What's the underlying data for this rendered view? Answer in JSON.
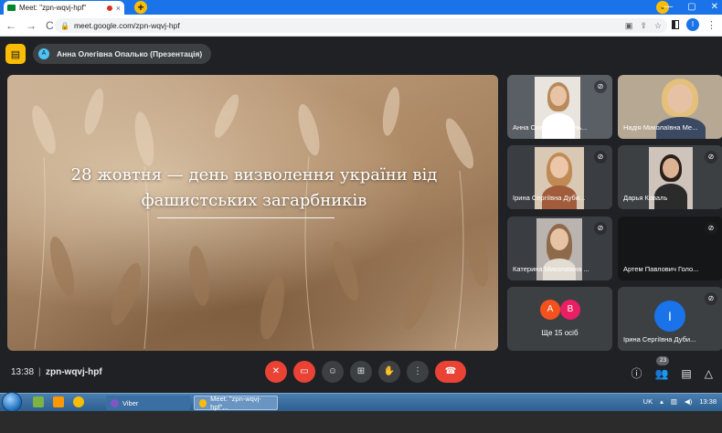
{
  "browser": {
    "tab_title": "Meet: \"zpn-wqvj-hpf\"",
    "tab_close": "×",
    "new_tab": "+",
    "tab_search": "⌄",
    "window_controls": [
      "—",
      "▢",
      "✕"
    ],
    "nav_back": "←",
    "nav_forward": "→",
    "nav_reload": "C",
    "url": "meet.google.com/zpn-wqvj-hpf",
    "profile_initial": "I"
  },
  "meet": {
    "presenter_label": "Анна Олегівна Опалько (Презентація)",
    "presenter_initial": "A",
    "slide_title_line1": "28 жовтня — день визволення україни від",
    "slide_title_line2": "фашистських загарбників",
    "participants": [
      {
        "name": "Анна Олегівна Опаль..."
      },
      {
        "name": "Надія Миколаївна Ме..."
      },
      {
        "name": "Ірина Сергіївна Дуби..."
      },
      {
        "name": "Дарья Коваль"
      },
      {
        "name": "Катерина Миколаївна ..."
      },
      {
        "name": "Артем Павлович Голо..."
      }
    ],
    "more_tile": {
      "avatars": [
        "A",
        "B"
      ],
      "label": "Ще 15 осіб",
      "colors": [
        "#f4511e",
        "#e91e63"
      ]
    },
    "last_tile": {
      "name": "Ірина Сергіївна Дуби...",
      "initial": "I"
    },
    "time": "13:38",
    "separator": "|",
    "meeting_code": "zpn-wqvj-hpf",
    "people_count": "23"
  },
  "taskbar": {
    "tasks": [
      "Viber",
      "Meet: \"zpn-wqvj-hpf\"..."
    ],
    "lang": "UK",
    "clock": "13:38"
  }
}
